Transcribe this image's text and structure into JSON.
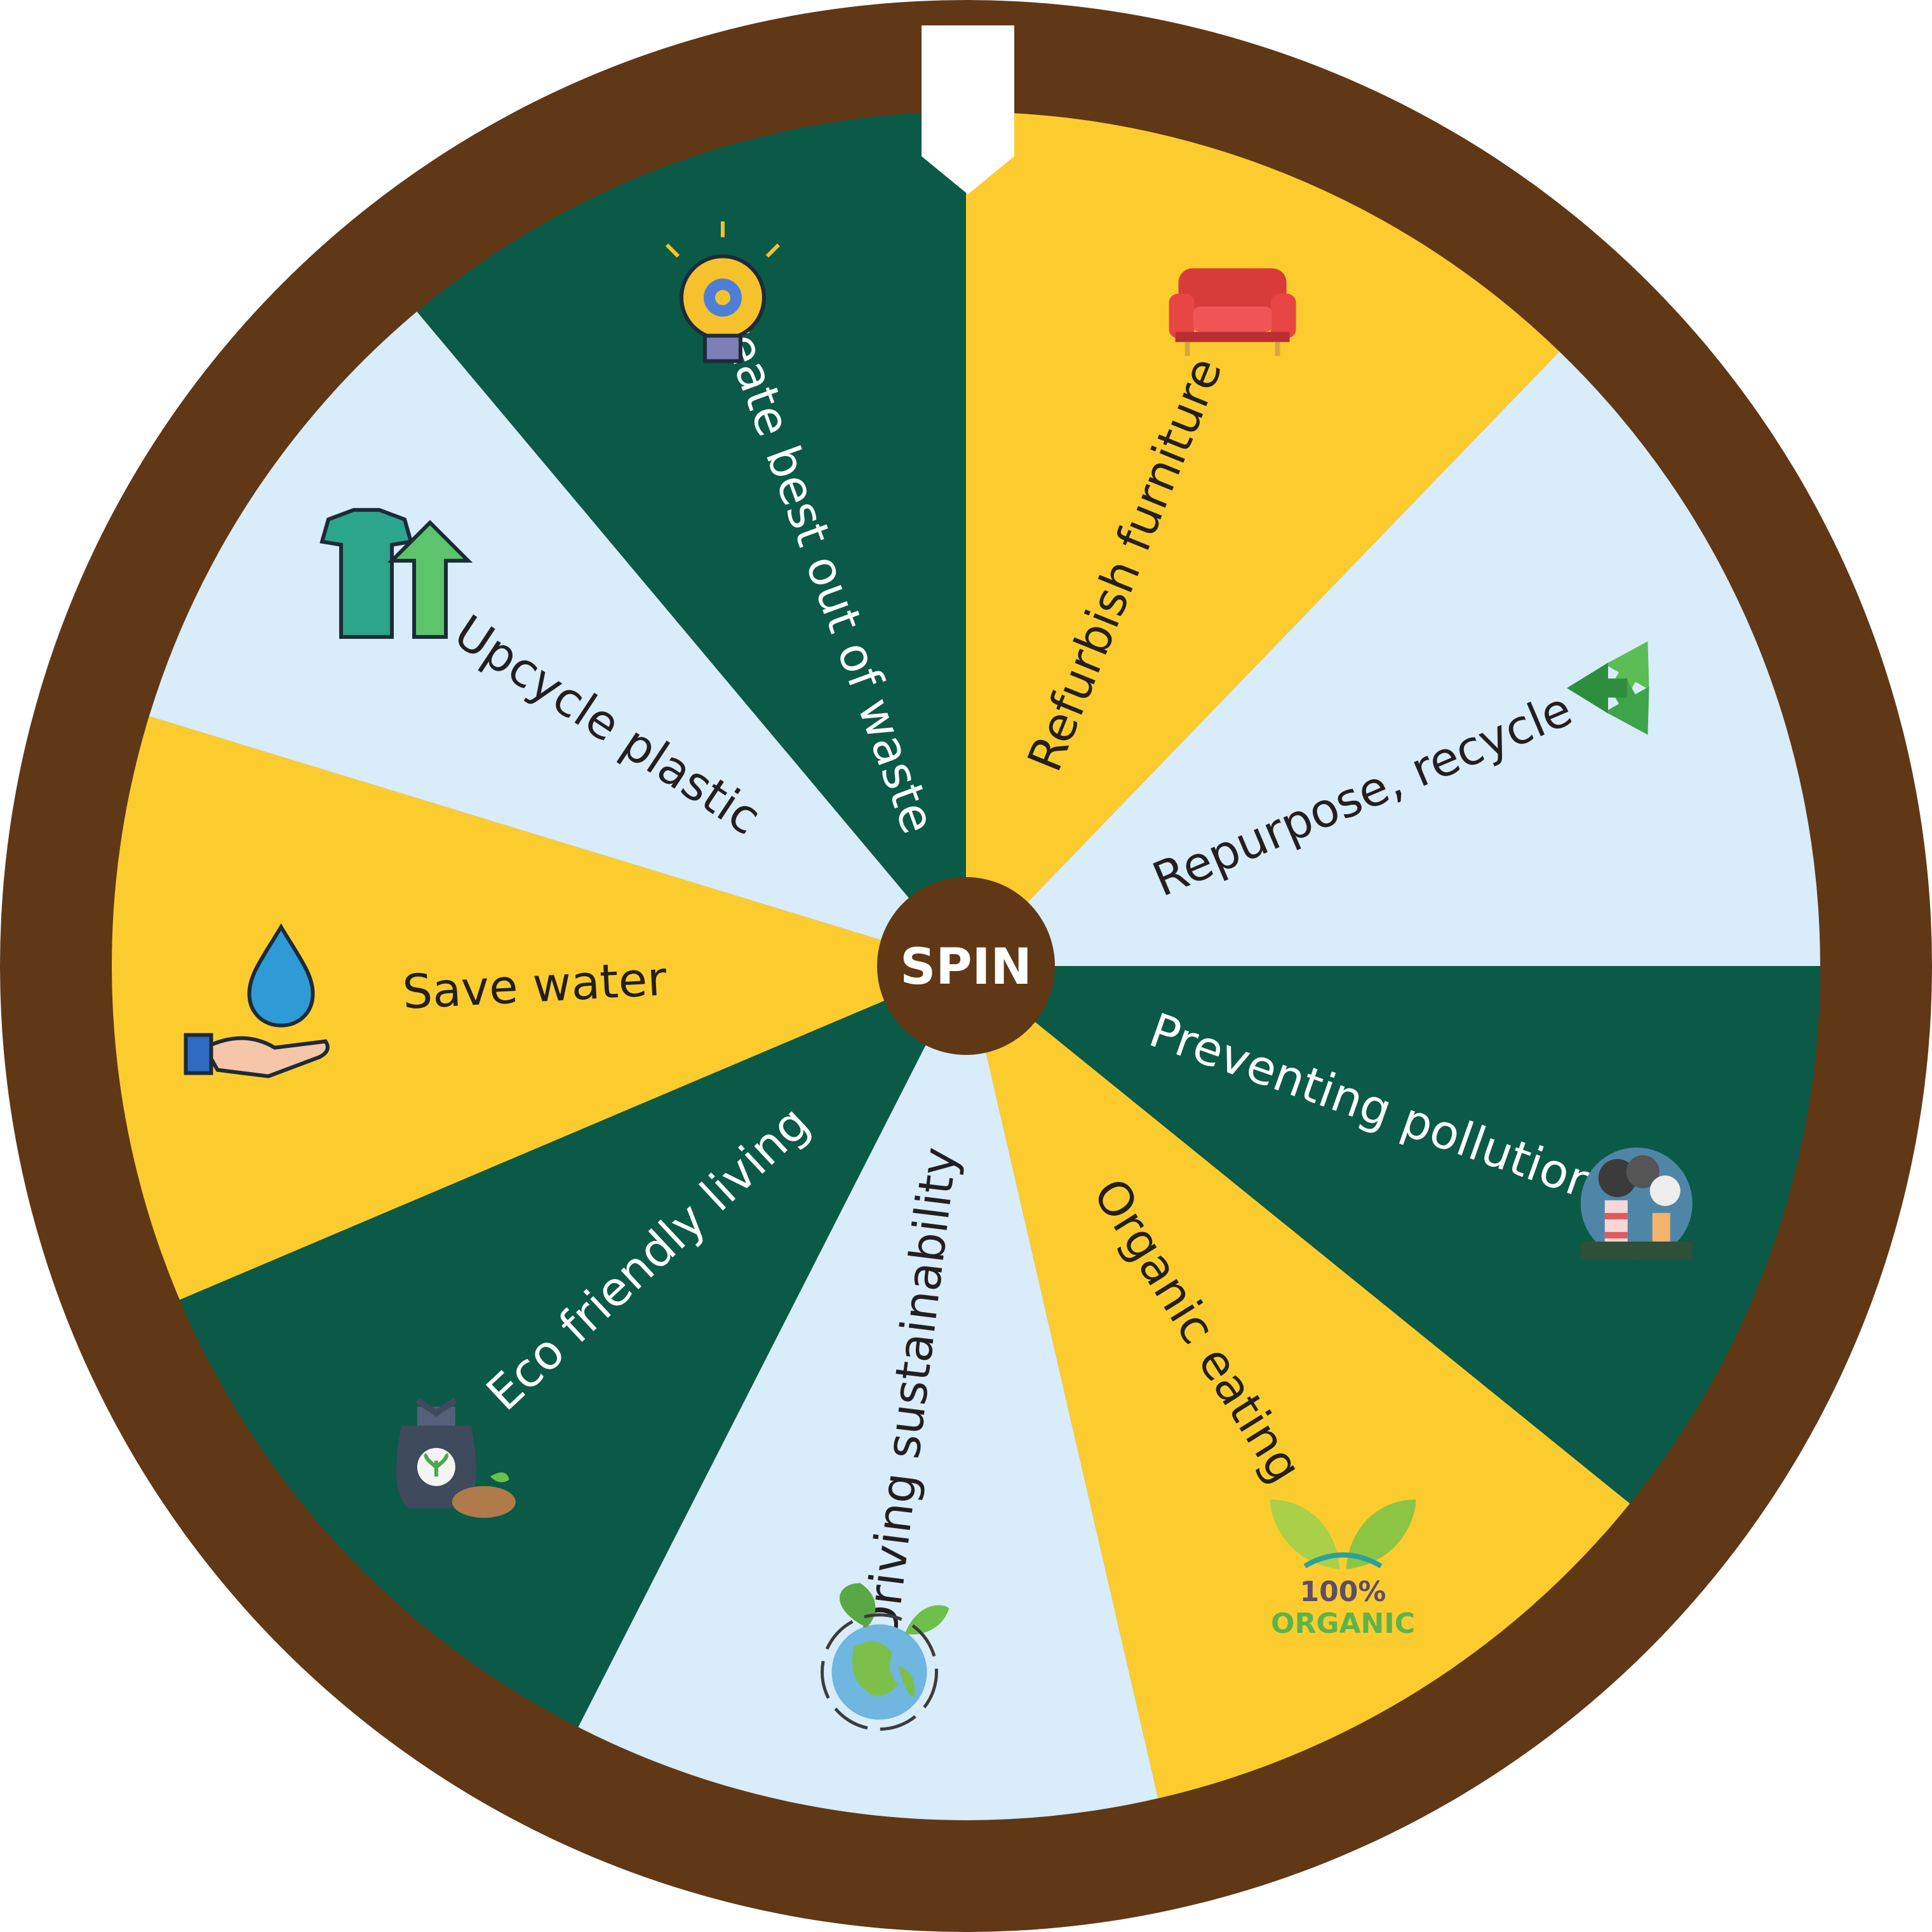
{
  "wheel": {
    "center_label": "SPIN",
    "colors": {
      "rim": "#603816",
      "yellow": "#FCCC2F",
      "dark_green": "#0A5A47",
      "light_blue": "#D8ECF9",
      "pointer": "#FFFFFF",
      "hub": "#603816",
      "hub_text": "#FFFFFF"
    },
    "segments": [
      {
        "label": "Refurbish furniture",
        "fill": "yellow",
        "text_color": "#231F20",
        "icon": "sofa-icon"
      },
      {
        "label": "Repurpose, recycle",
        "fill": "light_blue",
        "text_color": "#231F20",
        "icon": "recycle-icon"
      },
      {
        "label": "Preventing pollution",
        "fill": "dark_green",
        "text_color": "#FFFFFF",
        "icon": "factory-pollution-icon"
      },
      {
        "label": "Organic eating",
        "fill": "yellow",
        "text_color": "#231F20",
        "icon": "organic-leaves-icon",
        "icon_text_top": "100%",
        "icon_text_bottom": "ORGANIC"
      },
      {
        "label": "Driving sustainability",
        "fill": "light_blue",
        "text_color": "#231F20",
        "icon": "earth-leaves-icon"
      },
      {
        "label": "Eco friendly living",
        "fill": "dark_green",
        "text_color": "#FFFFFF",
        "icon": "compost-bag-icon"
      },
      {
        "label": "Save  water",
        "fill": "yellow",
        "text_color": "#231F20",
        "icon": "water-drop-hand-icon"
      },
      {
        "label": "Upcycle plastic",
        "fill": "light_blue",
        "text_color": "#231F20",
        "icon": "upcycle-shirt-icon"
      },
      {
        "label": "Create best out of waste",
        "fill": "dark_green",
        "text_color": "#FFFFFF",
        "icon": "lightbulb-gear-icon"
      }
    ]
  }
}
